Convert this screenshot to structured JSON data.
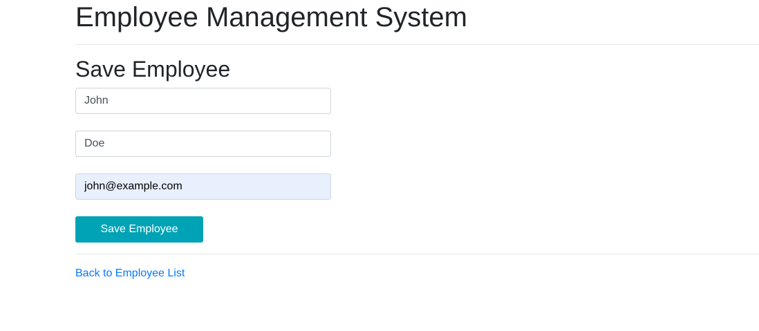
{
  "header": {
    "title": "Employee Management System"
  },
  "form": {
    "title": "Save Employee",
    "first_name": {
      "value": "John"
    },
    "last_name": {
      "value": "Doe"
    },
    "email": {
      "value": "john@example.com"
    },
    "save_label": "Save Employee"
  },
  "footer": {
    "back_link_label": "Back to Employee List"
  },
  "colors": {
    "primary_button": "#00a3b5",
    "link": "#007bff",
    "autofill_background": "#e8f0fe"
  }
}
